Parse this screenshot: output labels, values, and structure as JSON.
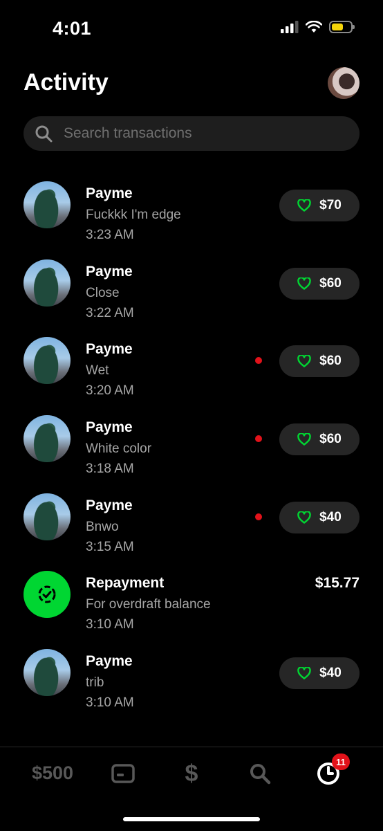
{
  "status": {
    "time": "4:01"
  },
  "header": {
    "title": "Activity"
  },
  "search": {
    "placeholder": "Search transactions"
  },
  "transactions": [
    {
      "name": "Payme",
      "note": "Fuckkk I'm edge",
      "time": "3:23 AM",
      "amount": "$70",
      "unread": false,
      "avatar": "statue-photo",
      "liked": true
    },
    {
      "name": "Payme",
      "note": "Close",
      "time": "3:22 AM",
      "amount": "$60",
      "unread": false,
      "avatar": "statue-photo",
      "liked": true
    },
    {
      "name": "Payme",
      "note": "Wet",
      "time": "3:20 AM",
      "amount": "$60",
      "unread": true,
      "avatar": "statue-photo",
      "liked": true
    },
    {
      "name": "Payme",
      "note": "White color",
      "time": "3:18 AM",
      "amount": "$60",
      "unread": true,
      "avatar": "statue-photo",
      "liked": true
    },
    {
      "name": "Payme",
      "note": "Bnwo",
      "time": "3:15 AM",
      "amount": "$40",
      "unread": true,
      "avatar": "statue-photo",
      "liked": true
    },
    {
      "name": "Repayment",
      "note": "For overdraft balance",
      "time": "3:10 AM",
      "amount": "$15.77",
      "unread": false,
      "avatar": "repayment-check-icon",
      "liked": false
    },
    {
      "name": "Payme",
      "note": "trib",
      "time": "3:10 AM",
      "amount": "$40",
      "unread": false,
      "avatar": "statue-photo",
      "liked": true
    }
  ],
  "nav": {
    "balance": "$500",
    "items": [
      "card-icon",
      "dollar-icon",
      "search-icon",
      "activity-clock-icon"
    ],
    "activity_badge": "11"
  },
  "colors": {
    "accent_green": "#00d632",
    "heart_green": "#00d632",
    "unread_red": "#e2121a",
    "pill_bg": "#262626"
  }
}
